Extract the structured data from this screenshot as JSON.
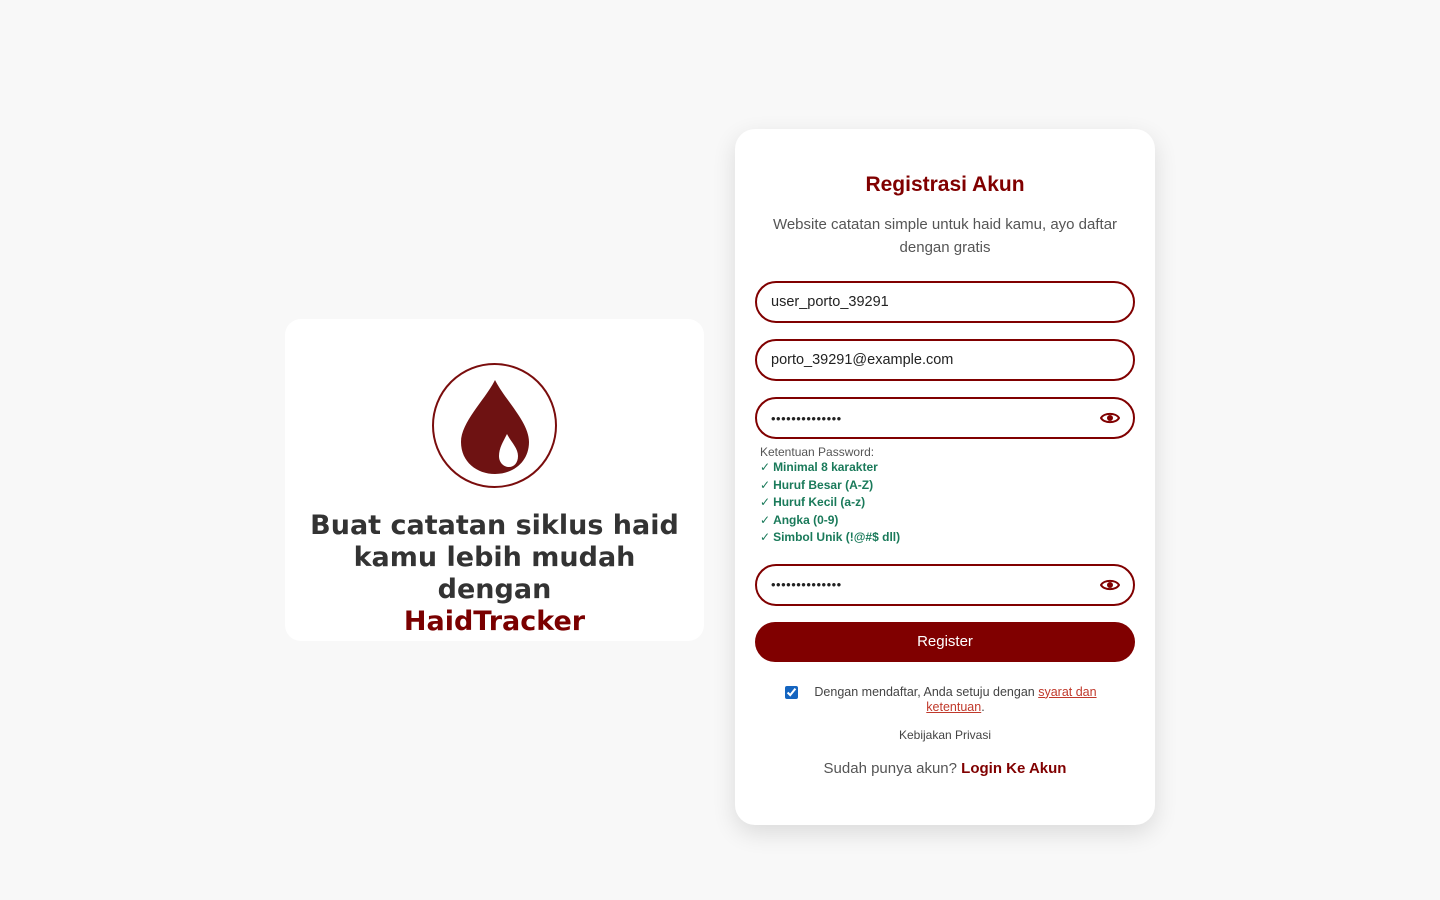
{
  "hero": {
    "line1": "Buat catatan siklus haid",
    "line2": "kamu lebih mudah dengan",
    "brand": "HaidTracker",
    "logo_icon": "blood-drop-icon"
  },
  "form": {
    "title": "Registrasi Akun",
    "subtitle": "Website catatan simple untuk haid kamu, ayo daftar dengan gratis",
    "username_value": "user_porto_39291",
    "email_value": "porto_39291@example.com",
    "password_value": "••••••••••••••",
    "confirm_password_value": "••••••••••••••",
    "rules_title": "Ketentuan Password:",
    "rules": [
      "Minimal 8 karakter",
      "Huruf Besar (A-Z)",
      "Huruf Kecil (a-z)",
      "Angka (0-9)",
      "Simbol Unik (!@#$ dll)"
    ],
    "check_mark": "✓",
    "register_label": "Register",
    "agree_prefix": "Dengan mendaftar, Anda setuju dengan",
    "agree_link": "syarat dan ketentuan",
    "agree_suffix": ".",
    "privacy_label": "Kebijakan Privasi",
    "login_prompt": "Sudah punya akun?",
    "login_link": "Login Ke Akun",
    "agree_checked": true
  },
  "colors": {
    "brand": "#800000",
    "rule_ok": "#1a7a5a",
    "background": "#f8f8f8"
  }
}
